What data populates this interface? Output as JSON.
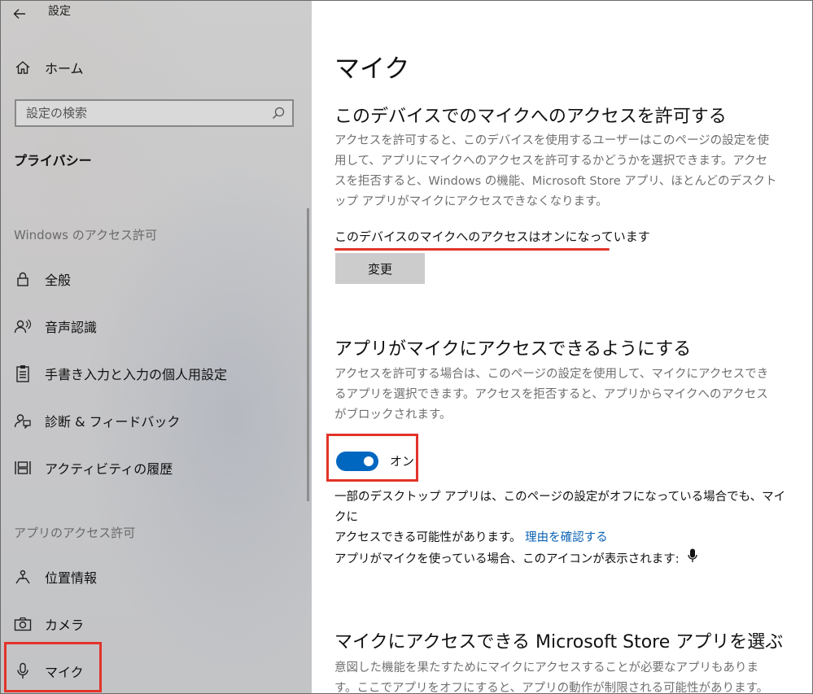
{
  "app_title": "設定",
  "sidebar": {
    "home_label": "ホーム",
    "search_placeholder": "設定の検索",
    "privacy_header": "プライバシー",
    "windows_section": "Windows のアクセス許可",
    "windows_items": [
      {
        "label": "全般",
        "icon": "lock-icon"
      },
      {
        "label": "音声認識",
        "icon": "speech-icon"
      },
      {
        "label": "手書き入力と入力の個人用設定",
        "icon": "clipboard-icon"
      },
      {
        "label": "診断 & フィードバック",
        "icon": "feedback-icon"
      },
      {
        "label": "アクティビティの履歴",
        "icon": "timeline-icon"
      }
    ],
    "apps_section": "アプリのアクセス許可",
    "app_items": [
      {
        "label": "位置情報",
        "icon": "location-icon"
      },
      {
        "label": "カメラ",
        "icon": "camera-icon"
      },
      {
        "label": "マイク",
        "icon": "microphone-icon",
        "selected": true
      }
    ]
  },
  "main": {
    "title": "マイク",
    "device_section": {
      "heading": "このデバイスでのマイクへのアクセスを許可する",
      "description": "アクセスを許可すると、このデバイスを使用するユーザーはこのページの設定を使用して、アプリにマイクへのアクセスを許可するかどうかを選択できます。アクセスを拒否すると、Windows の機能、Microsoft Store アプリ、ほとんどのデスクトップ アプリがマイクにアクセスできなくなります。",
      "status": "このデバイスのマイクへのアクセスはオンになっています",
      "change_button": "変更"
    },
    "apps_section": {
      "heading": "アプリがマイクにアクセスできるようにする",
      "description": "アクセスを許可する場合は、このページの設定を使用して、マイクにアクセスできるアプリを選択できます。アクセスを拒否すると、アプリからマイクへのアクセスがブロックされます。",
      "toggle_state": "オン",
      "desktop_note_1": "一部のデスクトップ アプリは、このページの設定がオフになっている場合でも、マイクに",
      "desktop_note_2": "アクセスできる可能性があります。",
      "why_link": "理由を確認する",
      "icon_note": "アプリがマイクを使っている場合、このアイコンが表示されます:"
    },
    "store_section": {
      "heading": "マイクにアクセスできる Microsoft Store アプリを選ぶ",
      "description": "意図した機能を果たすためにマイクにアクセスすることが必要なアプリもあります。ここでアプリをオフにすると、アプリの動作が制限される可能性があります。"
    }
  },
  "colors": {
    "accent": "#0067c0",
    "highlight": "#e2332a",
    "link": "#0b63b5"
  }
}
